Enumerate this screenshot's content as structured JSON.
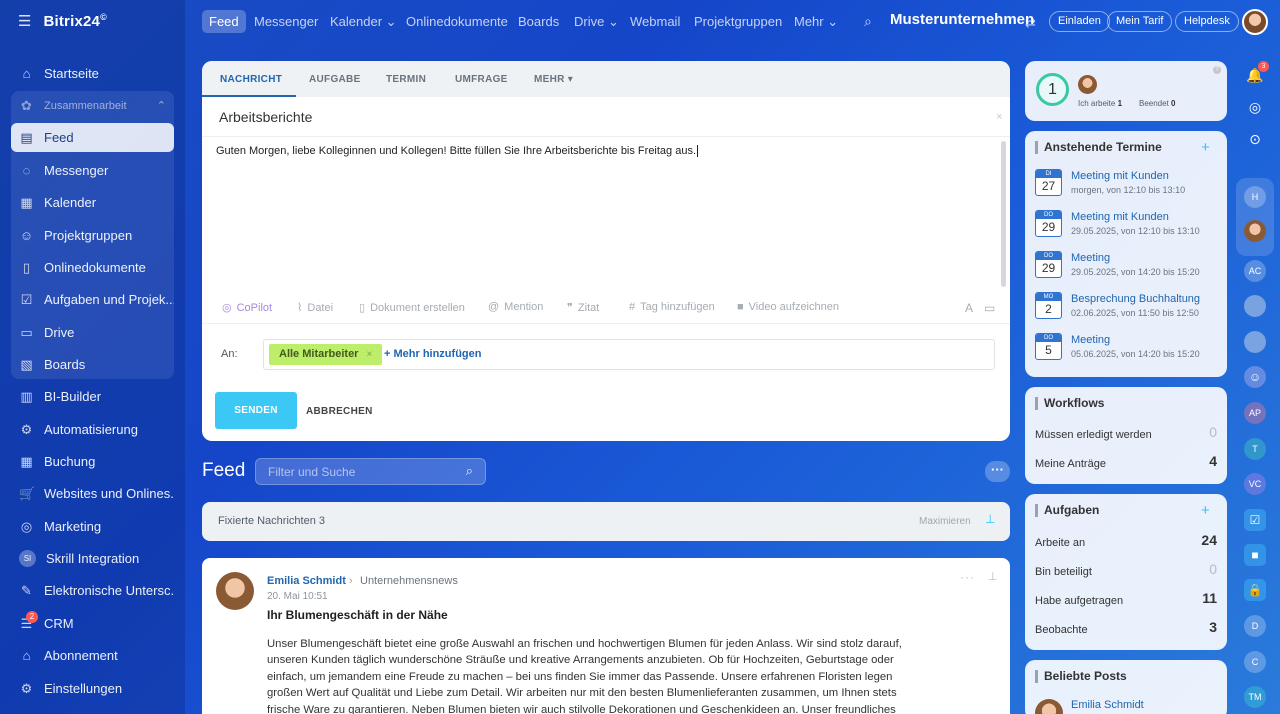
{
  "sidebar": {
    "logo": "Bitrix24",
    "logo_mark": "©",
    "items": [
      {
        "label": "Startseite",
        "icon": "⌂"
      },
      {
        "label": "Zusammenarbeit",
        "icon": "✿"
      },
      {
        "label": "Feed",
        "icon": "▤"
      },
      {
        "label": "Messenger",
        "icon": "◌"
      },
      {
        "label": "Kalender",
        "icon": "▦"
      },
      {
        "label": "Projektgruppen",
        "icon": "☺"
      },
      {
        "label": "Onlinedokumente",
        "icon": "▯"
      },
      {
        "label": "Aufgaben und Projek...",
        "icon": "☑"
      },
      {
        "label": "Drive",
        "icon": "▭"
      },
      {
        "label": "Boards",
        "icon": "▧"
      },
      {
        "label": "BI-Builder",
        "icon": "▥"
      },
      {
        "label": "Automatisierung",
        "icon": "⚙"
      },
      {
        "label": "Buchung",
        "icon": "▦"
      },
      {
        "label": "Websites und Onlines...",
        "icon": "🛒"
      },
      {
        "label": "Marketing",
        "icon": "◎"
      },
      {
        "label": "Skrill Integration",
        "icon": "SI"
      },
      {
        "label": "Elektronische Untersc...",
        "icon": "✎"
      },
      {
        "label": "CRM",
        "icon": "☰"
      },
      {
        "label": "Abonnement",
        "icon": "⌂"
      },
      {
        "label": "Einstellungen",
        "icon": "⚙"
      }
    ],
    "crm_badge": "2"
  },
  "topnav": {
    "items": [
      "Feed",
      "Messenger",
      "Kalender ⌄",
      "Onlinedokumente",
      "Boards",
      "Drive ⌄",
      "Webmail",
      "Projektgruppen",
      "Mehr ⌄"
    ],
    "company": "Musterunternehmen",
    "buttons": [
      "Einladen",
      "Mein Tarif",
      "Helpdesk"
    ]
  },
  "composer": {
    "tabs": [
      "NACHRICHT",
      "AUFGABE",
      "TERMIN",
      "UMFRAGE",
      "MEHR ▾"
    ],
    "title": "Arbeitsberichte",
    "body": "Guten Morgen, liebe Kolleginnen und Kollegen! Bitte füllen Sie Ihre Arbeitsberichte bis Freitag aus.",
    "tools": [
      "CoPilot",
      "Datei",
      "Dokument erstellen",
      "Mention",
      "Zitat",
      "Tag hinzufügen",
      "Video aufzeichnen"
    ],
    "to_label": "An:",
    "recipient": "Alle Mitarbeiter",
    "add_more": "+ Mehr hinzufügen",
    "send": "SENDEN",
    "cancel": "ABBRECHEN"
  },
  "feed": {
    "title": "Feed",
    "search_placeholder": "Filter und Suche",
    "pinned_label": "Fixierte Nachrichten",
    "pinned_count": "3",
    "maximize": "Maximieren"
  },
  "post": {
    "author": "Emilia Schmidt",
    "destination": "Unternehmensnews",
    "date": "20. Mai 10:51",
    "title": "Ihr Blumengeschäft in der Nähe",
    "body": "Unser Blumengeschäft bietet eine große Auswahl an frischen und hochwertigen Blumen für jeden Anlass. Wir sind stolz darauf, unseren Kunden täglich wunderschöne Sträuße und kreative Arrangements anzubieten. Ob für Hochzeiten, Geburtstage oder einfach, um jemandem eine Freude zu machen – bei uns finden Sie immer das Passende. Unsere erfahrenen Floristen legen großen Wert auf Qualität und Liebe zum Detail. Wir arbeiten nur mit den besten Blumenlieferanten zusammen, um Ihnen stets frische Ware zu garantieren. Neben Blumen bieten wir auch stilvolle Dekorationen und Geschenkideen an. Unser freundliches"
  },
  "timer": {
    "count": "1",
    "working_label": "Ich arbeite",
    "working_value": "1",
    "done_label": "Beendet",
    "done_value": "0"
  },
  "termine": {
    "title": "Anstehende Termine",
    "events": [
      {
        "dow": "DI",
        "day": "27",
        "title": "Meeting mit Kunden",
        "time": "morgen, von 12:10 bis 13:10"
      },
      {
        "dow": "DO",
        "day": "29",
        "title": "Meeting mit Kunden",
        "time": "29.05.2025, von 12:10 bis 13:10"
      },
      {
        "dow": "DO",
        "day": "29",
        "title": "Meeting",
        "time": "29.05.2025, von 14:20 bis 15:20"
      },
      {
        "dow": "MO",
        "day": "2",
        "title": "Besprechung Buchhaltung",
        "time": "02.06.2025, von 11:50 bis 12:50"
      },
      {
        "dow": "DO",
        "day": "5",
        "title": "Meeting",
        "time": "05.06.2025, von 14:20 bis 15:20"
      }
    ]
  },
  "workflows": {
    "title": "Workflows",
    "rows": [
      {
        "label": "Müssen erledigt werden",
        "value": "0"
      },
      {
        "label": "Meine Anträge",
        "value": "4"
      }
    ]
  },
  "aufgaben": {
    "title": "Aufgaben",
    "rows": [
      {
        "label": "Arbeite an",
        "value": "24"
      },
      {
        "label": "Bin beteiligt",
        "value": "0"
      },
      {
        "label": "Habe aufgetragen",
        "value": "11"
      },
      {
        "label": "Beobachte",
        "value": "3"
      }
    ]
  },
  "beliebte": {
    "title": "Beliebte Posts",
    "author": "Emilia Schmidt"
  },
  "rail": {
    "bell_badge": "3",
    "avatars": [
      "H",
      "AC",
      "AP",
      "T",
      "VC",
      "D",
      "C",
      "TM"
    ]
  },
  "colors": {
    "accent": "#2066b0",
    "send": "#3bc8f5",
    "recipient_tag": "#bcee6a"
  }
}
